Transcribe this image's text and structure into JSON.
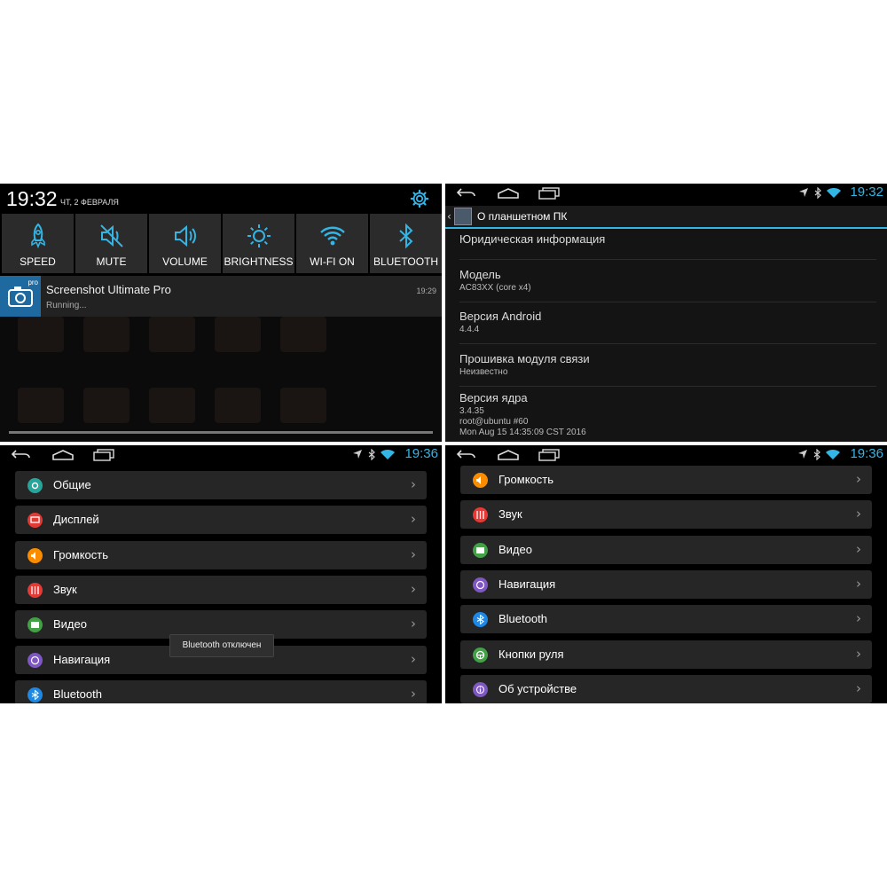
{
  "colors": {
    "accent": "#33b5e5",
    "general_icon": "#26a69a",
    "display_icon": "#e53935",
    "volume_icon": "#fb8c00",
    "sound_icon": "#e53935",
    "video_icon": "#43a047",
    "navigation_icon": "#7e57c2",
    "bluetooth_icon": "#1e88e5",
    "wheel_icon": "#43a047",
    "device_icon": "#7e57c2"
  },
  "shade": {
    "time": "19:32",
    "date": "ЧТ, 2 ФЕВРАЛЯ",
    "tiles": [
      {
        "label": "SPEED",
        "icon": "rocket-icon"
      },
      {
        "label": "MUTE",
        "icon": "mute-icon"
      },
      {
        "label": "VOLUME",
        "icon": "volume-icon"
      },
      {
        "label": "BRIGHTNESS",
        "icon": "brightness-icon"
      },
      {
        "label": "WI-FI ON",
        "icon": "wifi-icon"
      },
      {
        "label": "BLUETOOTH",
        "icon": "bluetooth-icon"
      }
    ],
    "notification": {
      "title": "Screenshot Ultimate Pro",
      "subtitle": "Running...",
      "time": "19:29",
      "badge": "pro"
    }
  },
  "about": {
    "status_time": "19:32",
    "title": "О планшетном ПК",
    "items": [
      {
        "title": "Юридическая информация",
        "sub": ""
      },
      {
        "title": "Модель",
        "sub": "AC83XX (core x4)"
      },
      {
        "title": "Версия Android",
        "sub": "4.4.4"
      },
      {
        "title": "Прошивка модуля связи",
        "sub": "Неизвестно"
      },
      {
        "title": "Версия ядра",
        "sub1": "3.4.35",
        "sub2": "root@ubuntu #60",
        "sub3": "Mon Aug 15 14:35:09 CST 2016"
      }
    ]
  },
  "menu_left": {
    "status_time": "19:36",
    "items": [
      {
        "label": "Общие",
        "icon": "settings-icon"
      },
      {
        "label": "Дисплей",
        "icon": "display-icon"
      },
      {
        "label": "Громкость",
        "icon": "volume-icon"
      },
      {
        "label": "Звук",
        "icon": "equalizer-icon"
      },
      {
        "label": "Видео",
        "icon": "video-icon"
      },
      {
        "label": "Навигация",
        "icon": "navigation-icon"
      },
      {
        "label": "Bluetooth",
        "icon": "bluetooth-icon"
      }
    ],
    "toast": "Bluetooth отключен"
  },
  "menu_right": {
    "status_time": "19:36",
    "items": [
      {
        "label": "Громкость",
        "icon": "volume-icon"
      },
      {
        "label": "Звук",
        "icon": "equalizer-icon"
      },
      {
        "label": "Видео",
        "icon": "video-icon"
      },
      {
        "label": "Навигация",
        "icon": "navigation-icon"
      },
      {
        "label": "Bluetooth",
        "icon": "bluetooth-icon"
      },
      {
        "label": "Кнопки руля",
        "icon": "steering-wheel-icon"
      },
      {
        "label": "Об устройстве",
        "icon": "info-icon"
      }
    ]
  },
  "chevron": "›"
}
